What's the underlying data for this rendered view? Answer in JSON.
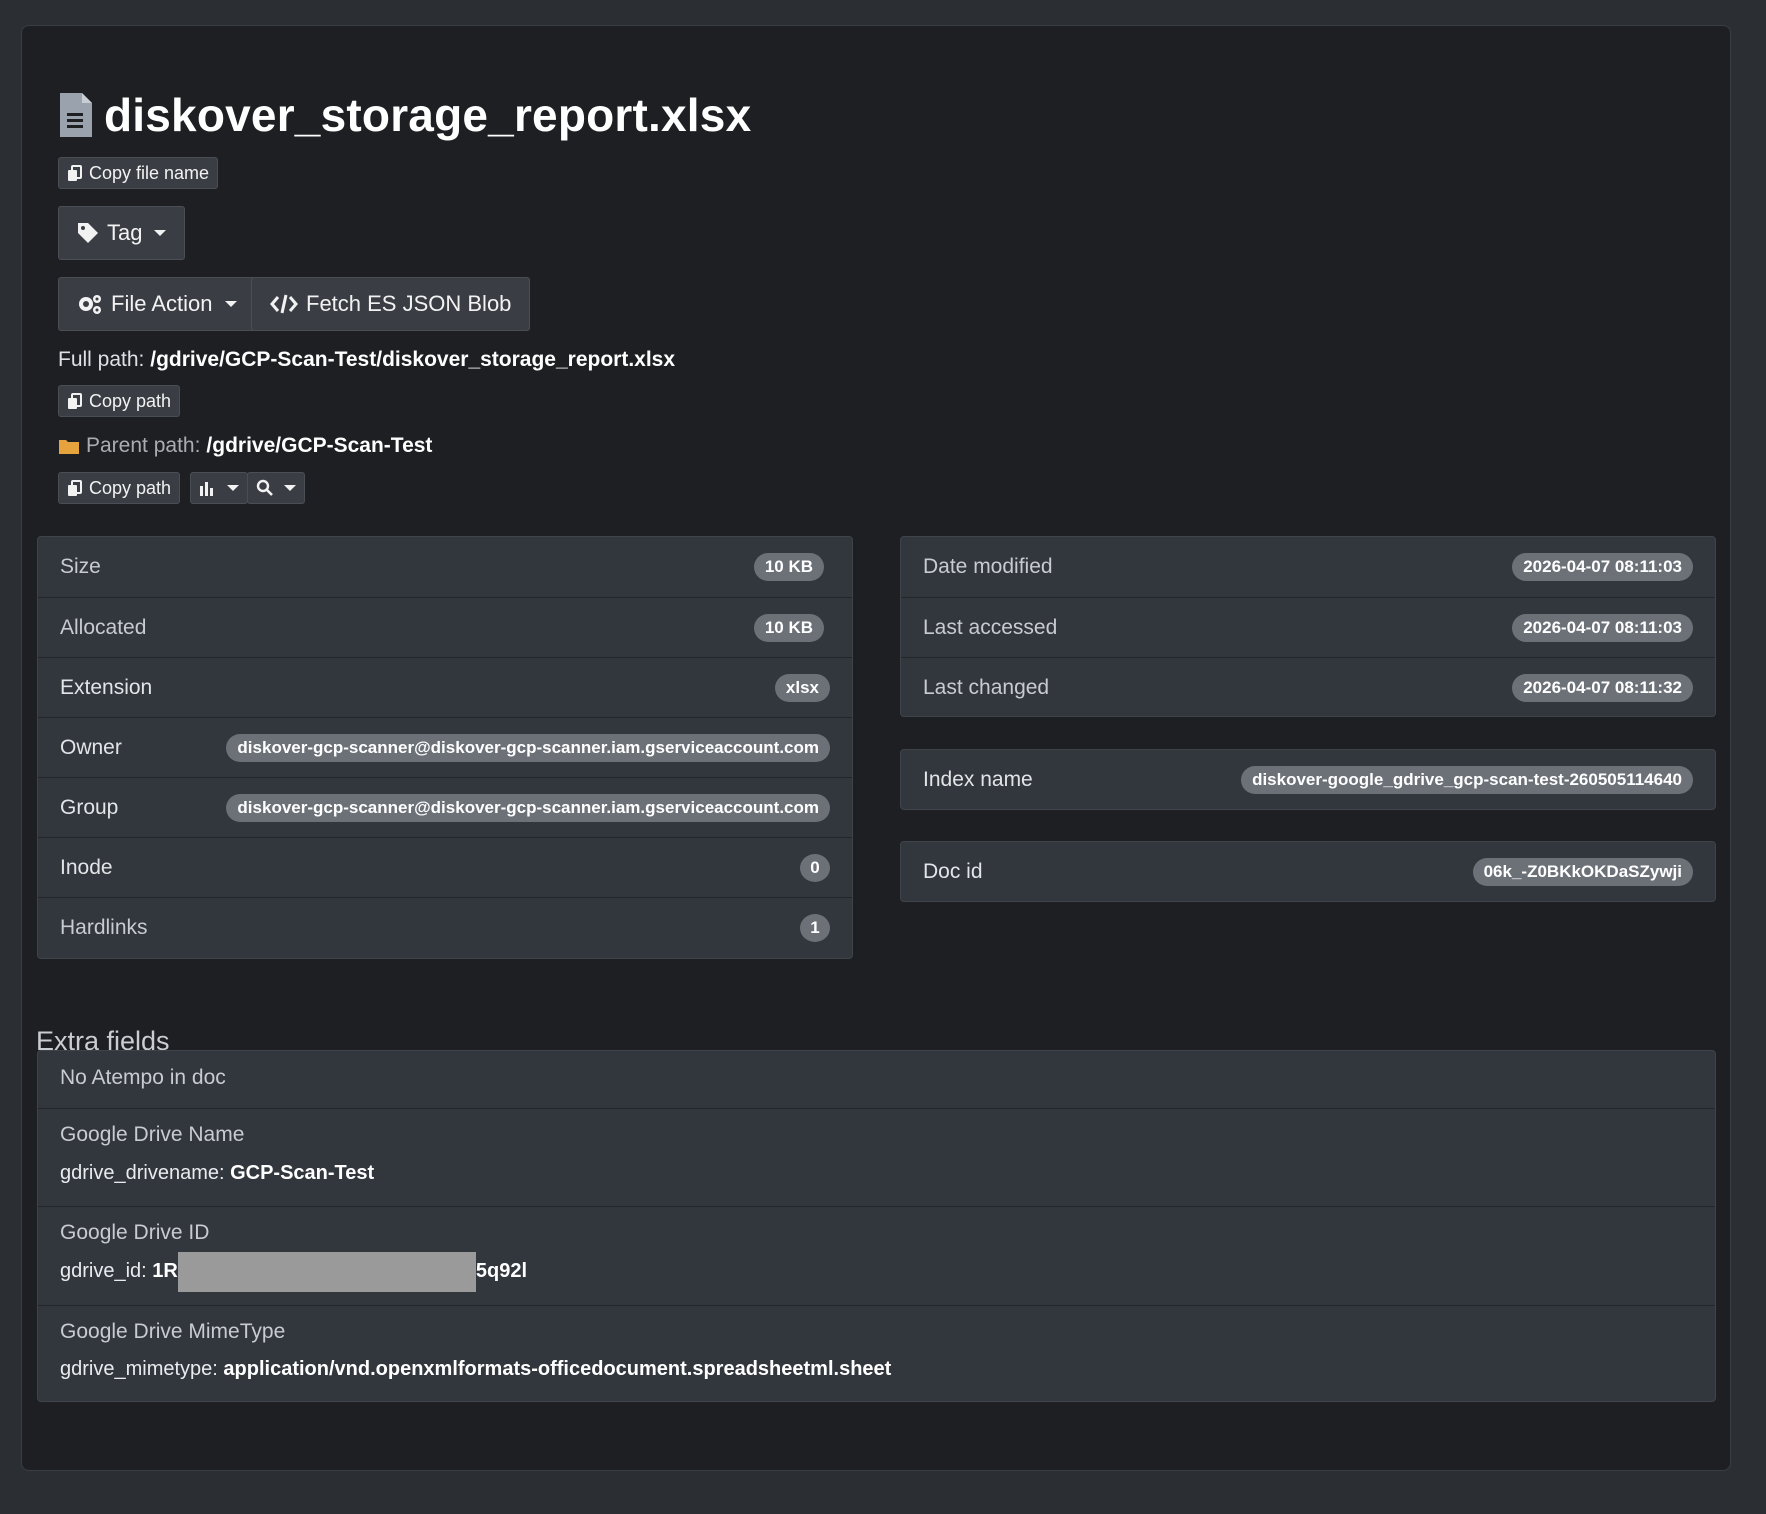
{
  "file": {
    "name": "diskover_storage_report.xlsx",
    "copy_file_name_label": "Copy file name",
    "tag_label": "Tag",
    "file_action_label": "File Action",
    "fetch_es_label": "Fetch ES JSON Blob",
    "full_path_label": "Full path:",
    "full_path_value": "/gdrive/GCP-Scan-Test/diskover_storage_report.xlsx",
    "copy_path_label": "Copy path",
    "parent_path_label": "Parent path:",
    "parent_path_value": "/gdrive/GCP-Scan-Test",
    "parent_copy_path_label": "Copy path"
  },
  "details_left": [
    {
      "label": "Size",
      "value": "10 KB"
    },
    {
      "label": "Allocated",
      "value": "10 KB"
    },
    {
      "label": "Extension",
      "value": "xlsx"
    },
    {
      "label": "Owner",
      "value": "diskover-gcp-scanner@diskover-gcp-scanner.iam.gserviceaccount.com"
    },
    {
      "label": "Group",
      "value": "diskover-gcp-scanner@diskover-gcp-scanner.iam.gserviceaccount.com"
    },
    {
      "label": "Inode",
      "value": "0"
    },
    {
      "label": "Hardlinks",
      "value": "1"
    }
  ],
  "details_right": [
    {
      "label": "Date modified",
      "value": "2026-04-07 08:11:03"
    },
    {
      "label": "Last accessed",
      "value": "2026-04-07 08:11:03"
    },
    {
      "label": "Last changed",
      "value": "2026-04-07 08:11:32"
    }
  ],
  "index": {
    "label": "Index name",
    "value": "diskover-google_gdrive_gcp-scan-test-260505114640"
  },
  "doc": {
    "label": "Doc id",
    "value": "06k_-Z0BKkOKDaSZywji"
  },
  "extra": {
    "title": "Extra fields",
    "no_atempo": "No Atempo in doc",
    "drive_name_title": "Google Drive Name",
    "drive_name_key": "gdrive_drivename:",
    "drive_name_value": "GCP-Scan-Test",
    "drive_id_title": "Google Drive ID",
    "drive_id_key": "gdrive_id:",
    "drive_id_prefix": "1R",
    "drive_id_suffix": "5q92l",
    "mimetype_title": "Google Drive MimeType",
    "mimetype_key": "gdrive_mimetype:",
    "mimetype_value": "application/vnd.openxmlformats-officedocument.spreadsheetml.sheet"
  },
  "colors": {
    "page_bg": "#2b2e33",
    "panel_bg": "#1d1f23",
    "card_bg": "#32363d",
    "badge_bg": "#6c7178",
    "folder": "#e6a23c"
  },
  "icons": [
    "file-text-icon",
    "copy-icon",
    "tag-icon",
    "cogs-icon",
    "code-icon",
    "folder-icon",
    "bar-chart-icon",
    "search-icon",
    "caret-down-icon"
  ]
}
